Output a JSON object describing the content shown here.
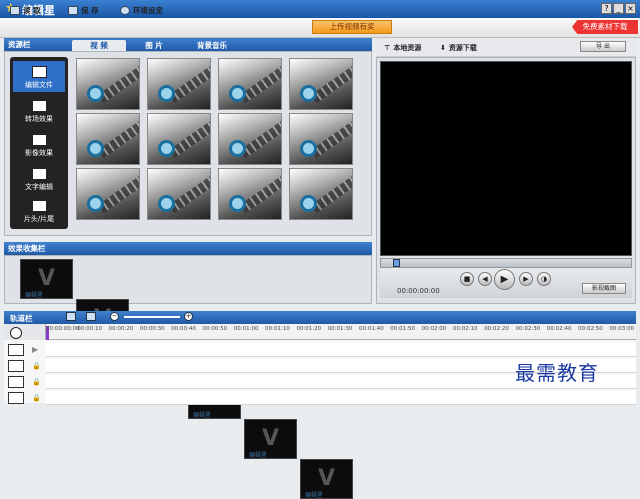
{
  "app": {
    "title": "编辑星"
  },
  "toolbar": {
    "open": "读 取",
    "save": "保 存",
    "settings": "环境设定",
    "upload": "上传视频有奖",
    "free_download": "免费素材下载"
  },
  "resource": {
    "title": "资源栏",
    "tabs": [
      "视 频",
      "图 片",
      "背景音乐"
    ],
    "sidebar": [
      "编辑文件",
      "转场效果",
      "影像效果",
      "文字编辑",
      "片头/片尾"
    ]
  },
  "effects": {
    "title": "效果收集栏",
    "watermark": "编辑星"
  },
  "preview": {
    "local": "本地资源",
    "download": "资源下载",
    "import": "导 出",
    "timecode": "00:00:00:00",
    "snapshot": "影视截图"
  },
  "timeline": {
    "title": "轨道栏",
    "ticks": [
      "00:00:00:00",
      "00:00:10",
      "00:00:20",
      "00:00:30",
      "00:00:40",
      "00:00:50",
      "00:01:00",
      "00:01:10",
      "00:01:20",
      "00:01:30",
      "00:01:40",
      "00:01:50",
      "00:02:00",
      "00:02:10",
      "00:02:20",
      "00:02:30",
      "00:02:40",
      "00:02:50",
      "00:03:00"
    ]
  },
  "brand_watermark": "最需教育"
}
